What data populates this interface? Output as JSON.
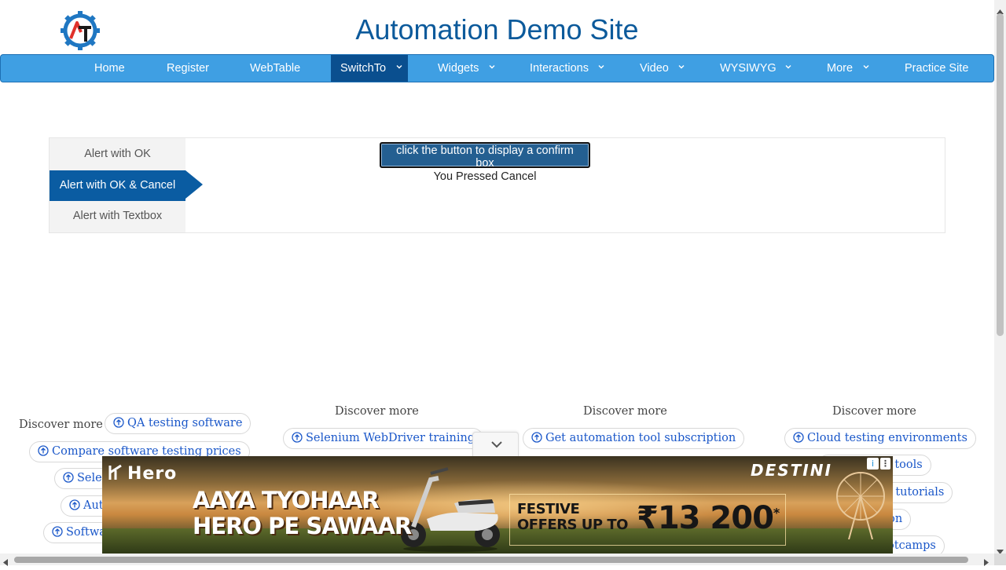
{
  "header": {
    "title": "Automation Demo Site",
    "logo_icon": "automation-testing-gear-logo"
  },
  "nav": {
    "items": [
      {
        "label": "Home"
      },
      {
        "label": "Register"
      },
      {
        "label": "WebTable"
      },
      {
        "label": "SwitchTo",
        "active": true,
        "dropdown": true
      },
      {
        "label": "Widgets",
        "dropdown": true
      },
      {
        "label": "Interactions",
        "dropdown": true
      },
      {
        "label": "Video",
        "dropdown": true
      },
      {
        "label": "WYSIWYG",
        "dropdown": true
      },
      {
        "label": "More",
        "dropdown": true
      },
      {
        "label": "Practice Site"
      }
    ]
  },
  "alerts": {
    "tabs": [
      {
        "label": "Alert with OK"
      },
      {
        "label": "Alert with OK & Cancel",
        "active": true
      },
      {
        "label": "Alert with Textbox"
      }
    ],
    "button_label": "click the button to display a confirm box",
    "result_text": "You Pressed Cancel"
  },
  "discover": {
    "heading": "Discover more",
    "col1": [
      "QA testing software",
      "Compare software testing prices",
      "Selen",
      "Aut",
      "Softwa"
    ],
    "col2": [
      "Selenium WebDriver training"
    ],
    "col3": [
      "Get automation tool subscription"
    ],
    "col4": [
      "Cloud testing environments",
      "ion tools",
      "ver tutorials",
      "ation",
      "bootcamps"
    ]
  },
  "ad": {
    "brand": "Hero",
    "headline_line1": "AAYA TYOHAAR",
    "headline_line2": "HERO PE SAWAAR",
    "offer_line1": "FESTIVE",
    "offer_line2": "OFFERS UP TO",
    "offer_amount": "₹13 200",
    "offer_mark": "*",
    "model": "DESTINI",
    "info_label": "i",
    "more_label": "⋮"
  },
  "colors": {
    "brand_blue": "#0c5a9b",
    "nav_bg": "#3f9fe3",
    "nav_active": "#0a4f8f",
    "tab_active": "#0a5ca2",
    "button_bg": "#245f91",
    "link_blue": "#1a57c9"
  }
}
